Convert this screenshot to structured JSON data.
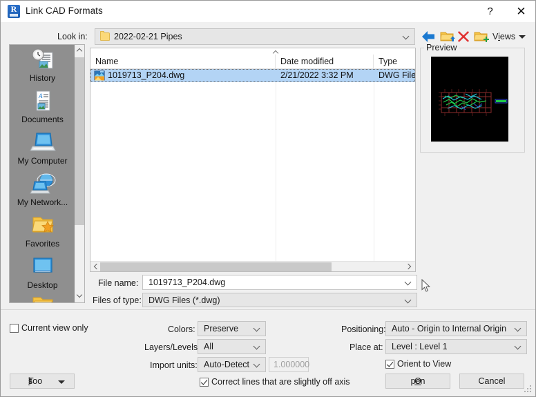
{
  "window": {
    "title": "Link CAD Formats",
    "app_icon": "revit-icon",
    "help_button": "?",
    "close_button": "✕"
  },
  "lookin": {
    "label": "Look in:",
    "value": "2022-02-21 Pipes",
    "icon": "folder-icon"
  },
  "toolbar": {
    "back_icon": "back-arrow-icon",
    "up_icon": "up-one-level-folder-icon",
    "delete_icon": "delete-x-icon",
    "new_folder_icon": "new-folder-icon",
    "views_label_pre": "V",
    "views_label_accel": "i",
    "views_label_post": "ews",
    "views_label": "Views"
  },
  "places": {
    "items": [
      {
        "label": "History",
        "icon": "history-clock-icon"
      },
      {
        "label": "Documents",
        "icon": "documents-page-icon"
      },
      {
        "label": "My Computer",
        "icon": "my-computer-laptop-icon"
      },
      {
        "label": "My Network...",
        "icon": "my-network-globe-icon"
      },
      {
        "label": "Favorites",
        "icon": "favorites-star-folder-icon"
      },
      {
        "label": "Desktop",
        "icon": "desktop-screen-icon"
      }
    ]
  },
  "filelist": {
    "columns": [
      "Name",
      "Date modified",
      "Type"
    ],
    "sort_indicator": "ascending-sort-icon",
    "rows": [
      {
        "name": "1019713_P204.dwg",
        "date": "2/21/2022 3:32 PM",
        "type": "DWG File",
        "icon": "dwg-file-icon",
        "selected": true
      }
    ]
  },
  "preview": {
    "legend": "Preview"
  },
  "filename": {
    "label": "File name:",
    "value": "1019713_P204.dwg"
  },
  "filetype": {
    "label": "Files of type:",
    "value": "DWG Files  (*.dwg)"
  },
  "options": {
    "current_view_only": {
      "label": "Current view only",
      "checked": false
    },
    "colors": {
      "label": "Colors:",
      "value": "Preserve"
    },
    "layers": {
      "label": "Layers/Levels:",
      "value": "All"
    },
    "import_units": {
      "label": "Import units:",
      "value": "Auto-Detect"
    },
    "scale_factor": {
      "value": "1.000000",
      "enabled": false
    },
    "correct_lines": {
      "label": "Correct lines that are slightly off axis",
      "checked": true
    },
    "positioning": {
      "label": "Positioning:",
      "value": "Auto - Origin to Internal Origin"
    },
    "place_at": {
      "label": "Place at:",
      "value": "Level : Level 1"
    },
    "orient_to_view": {
      "label": "Orient to View",
      "checked": true
    }
  },
  "buttons": {
    "tools_pre": "Too",
    "tools_accel": "l",
    "tools_post": "s",
    "tools": "Tools",
    "open_pre": "",
    "open_accel": "O",
    "open_post": "pen",
    "open": "Open",
    "cancel": "Cancel"
  },
  "colors": {
    "selection_blue": "#b3d4f5",
    "dialog_bg": "#f0f0f0",
    "places_bg": "#8f8f8f",
    "preview_bg": "#000000",
    "accent_blue": "#1b79d0",
    "delete_red": "#e03030",
    "folder_yellow": "#fbd979"
  }
}
